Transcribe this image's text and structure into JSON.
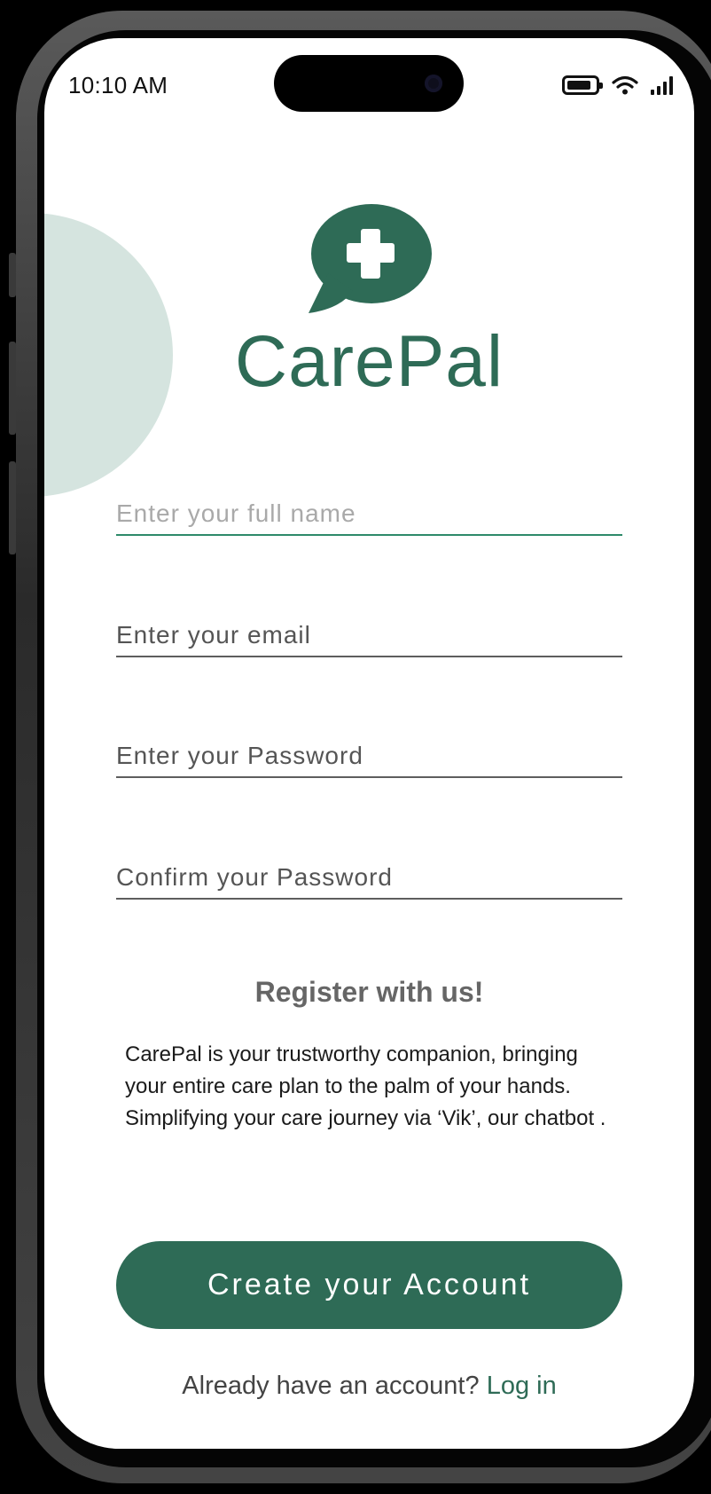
{
  "status_bar": {
    "time": "10:10 AM",
    "icons": [
      "battery-icon",
      "wifi-icon",
      "cellular-signal-icon"
    ]
  },
  "logo": {
    "icon": "chat-bubble-medical-cross-icon",
    "app_name": "CarePal"
  },
  "form": {
    "full_name": {
      "placeholder": "Enter your full name",
      "value": ""
    },
    "email": {
      "placeholder": "Enter your email",
      "value": ""
    },
    "password": {
      "placeholder": "Enter your Password",
      "value": ""
    },
    "confirm_password": {
      "placeholder": "Confirm your Password",
      "value": ""
    }
  },
  "intro": {
    "heading": "Register with us!",
    "description": "CarePal is your trustworthy companion, bringing your entire care plan to the palm of your hands. Simplifying your care journey via ‘Vik’, our chatbot ."
  },
  "actions": {
    "create_account_label": "Create your Account",
    "login_prompt": "Already have an account?",
    "login_link": "Log in"
  },
  "colors": {
    "brand_green": "#2e6b56",
    "decor_circle": "#d5e4df",
    "active_underline": "#2e8a6a",
    "background": "#ffffff"
  }
}
